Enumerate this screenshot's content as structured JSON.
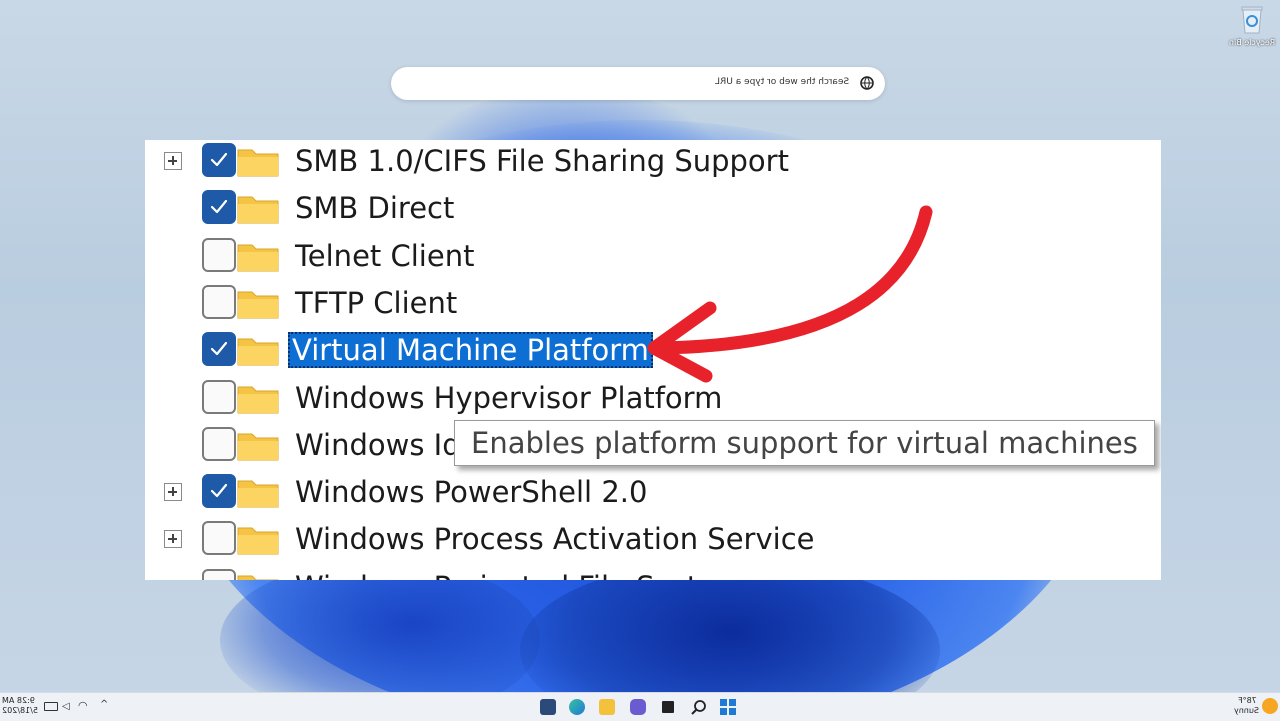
{
  "desktop": {
    "recycle_bin_label": "Recycle Bin"
  },
  "search": {
    "placeholder": "Search the web or type a URL"
  },
  "features": [
    {
      "label": "SMB 1.0/CIFS File Sharing Support",
      "checked": true,
      "expandable": true,
      "selected": false
    },
    {
      "label": "SMB Direct",
      "checked": true,
      "expandable": false,
      "selected": false
    },
    {
      "label": "Telnet Client",
      "checked": false,
      "expandable": false,
      "selected": false
    },
    {
      "label": "TFTP Client",
      "checked": false,
      "expandable": false,
      "selected": false
    },
    {
      "label": "Virtual Machine Platform",
      "checked": true,
      "expandable": false,
      "selected": true
    },
    {
      "label": "Windows Hypervisor Platform",
      "checked": false,
      "expandable": false,
      "selected": false
    },
    {
      "label": "Windows Id",
      "checked": false,
      "expandable": false,
      "selected": false
    },
    {
      "label": "Windows PowerShell 2.0",
      "checked": true,
      "expandable": true,
      "selected": false
    },
    {
      "label": "Windows Process Activation Service",
      "checked": false,
      "expandable": true,
      "selected": false
    },
    {
      "label": "Windows Projected File System",
      "checked": false,
      "expandable": false,
      "selected": false
    }
  ],
  "tooltip": {
    "text": "Enables platform support for virtual machines"
  },
  "taskbar": {
    "time": "9:28 AM",
    "date": "5/18/202",
    "weather_temp": "78°F",
    "weather_desc": "Sunny",
    "icons": [
      "windows-start-icon",
      "search-icon",
      "task-view-icon",
      "chat-icon",
      "file-explorer-icon",
      "edge-icon",
      "store-icon"
    ]
  },
  "colors": {
    "accent": "#1e5aa8",
    "selection": "#0d6fd4",
    "folder": "#f6c445",
    "arrow": "#e8222a"
  }
}
